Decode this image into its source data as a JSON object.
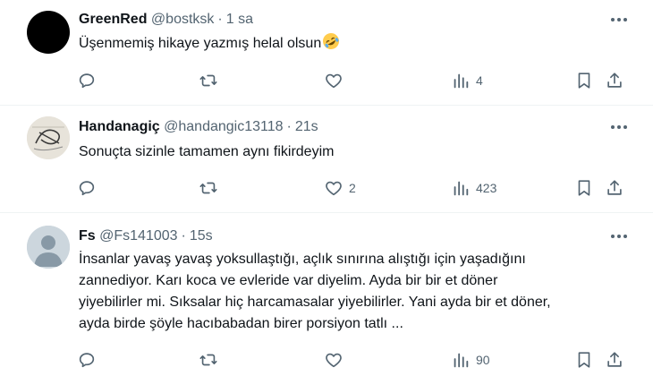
{
  "tweets": [
    {
      "name": "GreenRed",
      "handle": "@bostksk",
      "separator": "·",
      "time": "1 sa",
      "text": "Üşenmemiş hikaye yazmış helal olsun",
      "emoji": "rolling-on-floor-laughing-emoji",
      "reply_count": "",
      "retweet_count": "",
      "like_count": "",
      "view_count": "4"
    },
    {
      "name": "Handanagiç",
      "handle": "@handangic13118",
      "separator": "·",
      "time": "21s",
      "text": "Sonuçta sizinle tamamen aynı fikirdeyim",
      "reply_count": "",
      "retweet_count": "",
      "like_count": "2",
      "view_count": "423"
    },
    {
      "name": "Fs",
      "handle": "@Fs141003",
      "separator": "·",
      "time": "15s",
      "text": "İnsanlar yavaş yavaş yoksullaştığı, açlık sınırına alıştığı için yaşadığını\nzannediyor. Karı koca ve evleride var diyelim. Ayda bir bir et döner\nyiyebilirler mi. Sıksalar hiç harcamasalar yiyebilirler. Yani ayda bir et döner,\nayda birde şöyle hacıbabadan birer porsiyon tatlı ...",
      "reply_count": "",
      "retweet_count": "",
      "like_count": "",
      "view_count": "90"
    }
  ],
  "colors": {
    "text": "#0f1419",
    "secondary": "#536471",
    "divider": "#eff3f4"
  },
  "icons": [
    "more-icon",
    "reply-icon",
    "retweet-icon",
    "like-icon",
    "views-icon",
    "bookmark-icon",
    "share-icon"
  ]
}
